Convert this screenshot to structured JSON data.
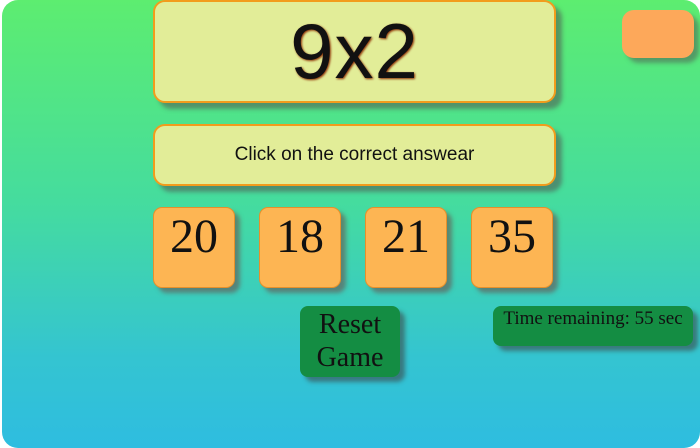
{
  "question": {
    "text": "9x2"
  },
  "instruction": {
    "text": "Click on the correct answear"
  },
  "score": {
    "value": ""
  },
  "answers": [
    {
      "label": "20"
    },
    {
      "label": "18"
    },
    {
      "label": "21"
    },
    {
      "label": "35"
    }
  ],
  "reset_button": {
    "line1": "Reset",
    "line2": "Game"
  },
  "timer": {
    "text": "Time remaining: 55 sec"
  },
  "colors": {
    "gradient_top": "#5ded70",
    "gradient_bottom": "#2ebde0",
    "panel": "#e2ed98",
    "panel_border": "#f29c1c",
    "answer_tile": "#fdb553",
    "score_box": "#fda85a",
    "green_button": "#148d43"
  }
}
